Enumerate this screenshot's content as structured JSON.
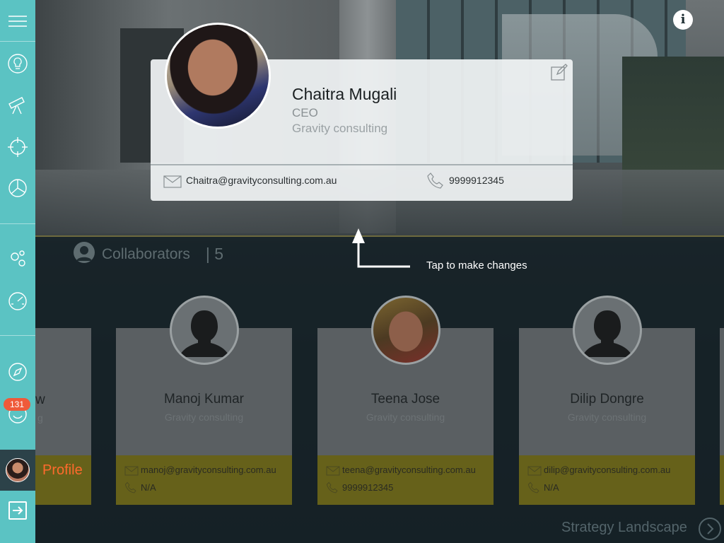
{
  "profile_card": {
    "name": "Chaitra Mugali",
    "role": "CEO",
    "company": "Gravity consulting",
    "email": "Chaitra@gravityconsulting.com.au",
    "phone": "9999912345"
  },
  "tooltip": {
    "text": "Tap to make changes"
  },
  "collaborators": {
    "title": "Collaborators",
    "count": "| 5",
    "partial_card": {
      "name_tail": "w",
      "company_tail": "g"
    },
    "items": [
      {
        "name": "Manoj Kumar",
        "company": "Gravity consulting",
        "email": "manoj@gravityconsulting.com.au",
        "phone": "N/A",
        "avatar": "placeholder"
      },
      {
        "name": "Teena Jose",
        "company": "Gravity consulting",
        "email": "teena@gravityconsulting.com.au",
        "phone": "9999912345",
        "avatar": "photo"
      },
      {
        "name": "Dilip Dongre",
        "company": "Gravity consulting",
        "email": "dilip@gravityconsulting.com.au",
        "phone": "N/A",
        "avatar": "placeholder"
      }
    ]
  },
  "sidebar": {
    "items": [
      {
        "icon": "menu-icon"
      },
      {
        "icon": "lightbulb-icon"
      },
      {
        "icon": "telescope-icon"
      },
      {
        "icon": "target-icon"
      },
      {
        "icon": "pie-chart-icon"
      },
      {
        "icon": "gears-icon"
      },
      {
        "icon": "speedometer-icon"
      },
      {
        "icon": "compass-icon"
      },
      {
        "icon": "smiley-icon"
      },
      {
        "icon": "logout-icon"
      }
    ],
    "notification_badge": "131",
    "profile_label": "Profile"
  },
  "footer": {
    "strategy_label": "Strategy Landscape"
  },
  "colors": {
    "sidebar": "#5bc3c3",
    "accent_orange": "#ff6a2d",
    "badge_red": "#ef5a3a",
    "footer_yellow": "#66611a"
  }
}
